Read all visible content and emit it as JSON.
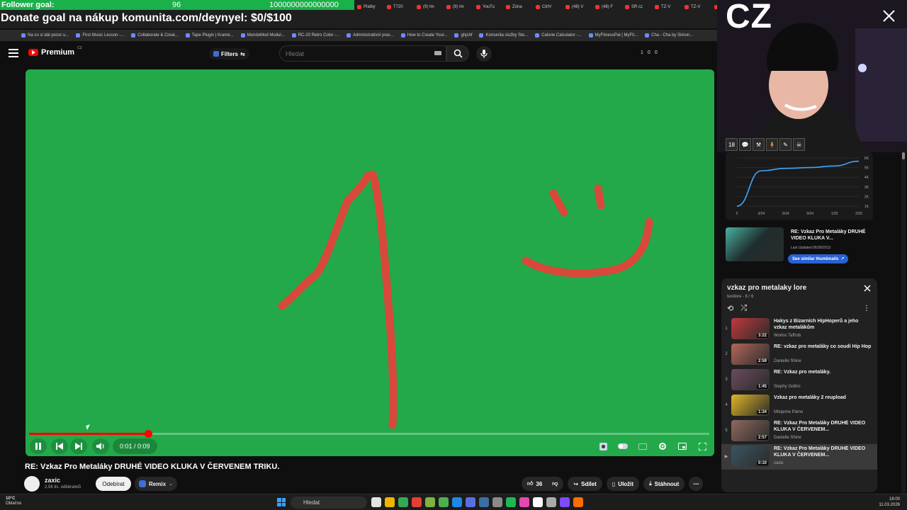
{
  "browser": {
    "tabs": [
      "Platby",
      "T720",
      "(9) Im",
      "(9) Im",
      "YouTu",
      "Zóna",
      "CtrlV",
      "(48) V",
      "(48) F",
      "SR cz",
      "TZ-V",
      "TZ-V",
      "Místn"
    ],
    "bookmarks": [
      "Na co si dát pozor u...",
      "First Music Lesson -...",
      "Collaborate & Creat...",
      "Tape Plugin | Krame...",
      "MondoMod Modul...",
      "RC-20 Retro Color -...",
      "Administrativní prac...",
      "How to Create Your...",
      "ghjshf",
      "Komunita služby Ste...",
      "Calorie Calculator -...",
      "MyFitnessPal | MyFit...",
      "Cha - Cha by Simon..."
    ]
  },
  "overlay": {
    "follower_label": "Follower goal:",
    "follower_count": "96",
    "follower_target": "1000000000000000",
    "donate_text": "Donate goal na nákup komunita.com/deynyel: $0/$100",
    "webcam_label": "CZ",
    "webcam_badges": [
      "18",
      "💬",
      "⚒",
      "🧍",
      "✎",
      "☠"
    ]
  },
  "header": {
    "logo_text": "Premium",
    "logo_region": "CZ",
    "filters_label": "Filters",
    "search_placeholder": "Hledat",
    "stats": [
      "1",
      "0",
      "0"
    ]
  },
  "player": {
    "progress": 0.175,
    "time": "0:01 / 0:09"
  },
  "video": {
    "title": "RE: Vzkaz Pro Metaláky DRUHÉ VIDEO KLUKA V ČERVENEM TRIKU.",
    "channel": "zaxic",
    "subscribers": "2,56 tis. odběratelů",
    "subscribe_label": "Odebírat",
    "remix_label": "Remix",
    "likes": "36",
    "share_label": "Sdílet",
    "save_label": "Uložit",
    "download_label": "Stáhnout"
  },
  "stats_chart": {
    "chart_data": {
      "type": "line",
      "x": [
        "0",
        "3/24",
        "6/24",
        "9/24",
        "1/25",
        "2/25"
      ],
      "yticks": [
        "6K",
        "5K",
        "4K",
        "3K",
        "2K",
        "1K"
      ],
      "values": [
        0,
        4400,
        4700,
        4800,
        5000,
        5600
      ]
    }
  },
  "recommendation": {
    "title": "RE: Vzkaz Pro Metaláky DRUHÉ VIDEO KLUKA V...",
    "updated": "Last Updated 06/26/2013",
    "similar_label": "See similar thumbnails"
  },
  "playlist": {
    "title": "vzkaz pro metalaky lore",
    "meta": "teodore - 6 / 6",
    "items": [
      {
        "index": "1",
        "title": "Hakys z Bizarních HipHoperů a jeho vzkaz metalákům",
        "channel": "Worlos Taffrob",
        "duration": "3:22",
        "color": "#c0393b"
      },
      {
        "index": "2",
        "title": "RE: vzkaz pro metaláky co soudí Hip Hop",
        "channel": "Danielle Shine",
        "duration": "2:59",
        "color": "#b2675a"
      },
      {
        "index": "3",
        "title": "RE: Vzkaz pro metaláky.",
        "channel": "Stephy Gothic",
        "duration": "1:45",
        "color": "#6a4b5c"
      },
      {
        "index": "4",
        "title": "Vzkaz pro metaláky 2 reupload",
        "channel": "Milujeme Pámo",
        "duration": "1:34",
        "color": "#e1b526"
      },
      {
        "index": "5",
        "title": "RE: Vzkaz Pro Metaláky DRUHÉ VIDEO KLUKA V ČERVENEM...",
        "channel": "Danielle Shine",
        "duration": "2:57",
        "color": "#8f6a60"
      },
      {
        "index": "▶",
        "title": "RE: Vzkaz Pro Metaláky DRUHÉ VIDEO KLUKA V ČERVENEM...",
        "channel": "zaxic",
        "duration": "0:10",
        "color": "#3a5560"
      }
    ]
  },
  "taskbar": {
    "temp": "10°C",
    "weather": "Oblačno",
    "search": "Hledat",
    "time": "18:00",
    "date": "11.03.2026"
  }
}
